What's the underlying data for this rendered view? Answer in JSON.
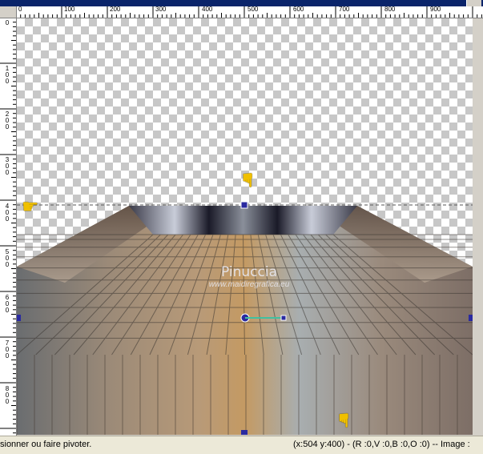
{
  "ruler": {
    "horizontal_labels": [
      "0",
      "100",
      "200",
      "300",
      "400",
      "500",
      "600",
      "700",
      "800",
      "900"
    ],
    "vertical_labels": [
      "0",
      "100",
      "200",
      "300",
      "400",
      "500",
      "600",
      "700",
      "800"
    ]
  },
  "watermark": {
    "title": "Pinuccia",
    "url": "www.maidiregrafica.eu"
  },
  "status": {
    "hint": "sionner ou faire pivoter.",
    "readout": "(x:504 y:400) - (R :0,V :0,B :0,O :0) -- Image :"
  },
  "colors": {
    "canvas_checker": "#c7c7c7",
    "guide_line": "#555555",
    "handle": "#2a2aa0",
    "hand_pointer": "#f0c000"
  },
  "icons": [
    "hand-pointer-right-icon",
    "hand-pointer-down-icon"
  ]
}
